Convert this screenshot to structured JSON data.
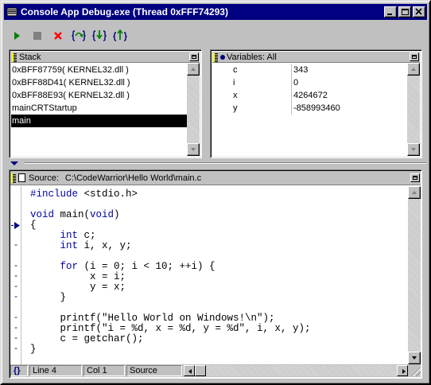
{
  "window": {
    "title": "Console App Debug.exe (Thread 0xFFF74293)"
  },
  "toolbar": {
    "buttons": [
      {
        "name": "run",
        "icon": "play-icon",
        "color": "#008000"
      },
      {
        "name": "stop",
        "icon": "stop-icon",
        "color": "#808080"
      },
      {
        "name": "kill",
        "icon": "kill-icon",
        "color": "#ff0000"
      },
      {
        "name": "step-over",
        "icon": "step-over-icon",
        "color": "#008000"
      },
      {
        "name": "step-into",
        "icon": "step-into-icon",
        "color": "#008000"
      },
      {
        "name": "step-out",
        "icon": "step-out-icon",
        "color": "#008000"
      }
    ]
  },
  "stack": {
    "title": "Stack",
    "items": [
      "0xBFF87759( KERNEL32.dll )",
      "0xBFF88D41( KERNEL32.dll )",
      "0xBFF88E93( KERNEL32.dll )",
      "mainCRTStartup",
      "main"
    ],
    "selected_index": 4
  },
  "variables": {
    "title": "Variables: All",
    "rows": [
      {
        "name": "c",
        "value": "343"
      },
      {
        "name": "i",
        "value": "0"
      },
      {
        "name": "x",
        "value": "4264672"
      },
      {
        "name": "y",
        "value": "-858993460"
      }
    ]
  },
  "source": {
    "label": "Source:",
    "path": "C:\\CodeWarrior\\Hello World\\main.c",
    "lines": [
      "#include <stdio.h>",
      "",
      "void main(void)",
      "{",
      "     int c;",
      "     int i, x, y;",
      "",
      "     for (i = 0; i < 10; ++i) {",
      "          x = i;",
      "          y = x;",
      "     }",
      "",
      "     printf(\"Hello World on Windows!\\n\");",
      "     printf(\"i = %d, x = %d, y = %d\", i, x, y);",
      "     c = getchar();",
      "}"
    ],
    "gutter_marks": [
      "",
      "",
      "",
      "-",
      "",
      "-",
      "",
      "-",
      "-",
      "-",
      "-",
      "",
      "-",
      "-",
      "-",
      "-"
    ],
    "current_line_index": 3
  },
  "statusbar": {
    "braces": "{}",
    "line": "Line 4",
    "col": "Col 1",
    "mode": "Source"
  },
  "colors": {
    "title_bg": "#000080",
    "face": "#c0c0c0",
    "selection": "#000000"
  }
}
